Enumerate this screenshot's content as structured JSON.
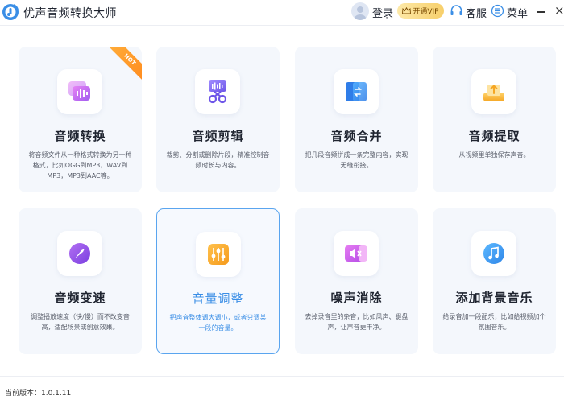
{
  "titlebar": {
    "app_title": "优声音频转换大师",
    "login": "登录",
    "vip": "开通VIP",
    "service": "客服",
    "menu": "菜单",
    "close": "×"
  },
  "colors": {
    "accent": "#3a8ee6",
    "vip_gold": "#f7cf6a",
    "hot_orange": "#ff8a1e",
    "card_bg": "#f4f7fc"
  },
  "cards": [
    {
      "title": "音频转换",
      "desc": "将音频文件从一种格式转换为另一种格式，比如OGG到MP3，WAV到MP3，MP3到AAC等。",
      "badge": "HOT",
      "icon": "audio-convert-icon",
      "selected": false
    },
    {
      "title": "音频剪辑",
      "desc": "裁剪、分割或删除片段，精准控制音频时长与内容。",
      "badge": "",
      "icon": "audio-cut-icon",
      "selected": false
    },
    {
      "title": "音频合并",
      "desc": "把几段音频拼成一条完整内容，实现无缝衔接。",
      "badge": "",
      "icon": "audio-merge-icon",
      "selected": false
    },
    {
      "title": "音频提取",
      "desc": "从视频里单独保存声音。",
      "badge": "",
      "icon": "audio-extract-icon",
      "selected": false
    },
    {
      "title": "音频变速",
      "desc": "调整播放速度（快/慢）而不改变音高，适配场景或创意效果。",
      "badge": "",
      "icon": "audio-speed-icon",
      "selected": false
    },
    {
      "title": "音量调整",
      "desc": "把声音整体调大调小，或者只调某一段的音量。",
      "badge": "",
      "icon": "volume-adjust-icon",
      "selected": true
    },
    {
      "title": "噪声消除",
      "desc": "去掉录音里的杂音，比如风声、键盘声，让声音更干净。",
      "badge": "",
      "icon": "noise-remove-icon",
      "selected": false
    },
    {
      "title": "添加背景音乐",
      "desc": "给录音加一段配乐，比如给视频加个氛围音乐。",
      "badge": "",
      "icon": "background-music-icon",
      "selected": false
    }
  ],
  "footer": {
    "version": "当前版本：1.0.1.11"
  }
}
